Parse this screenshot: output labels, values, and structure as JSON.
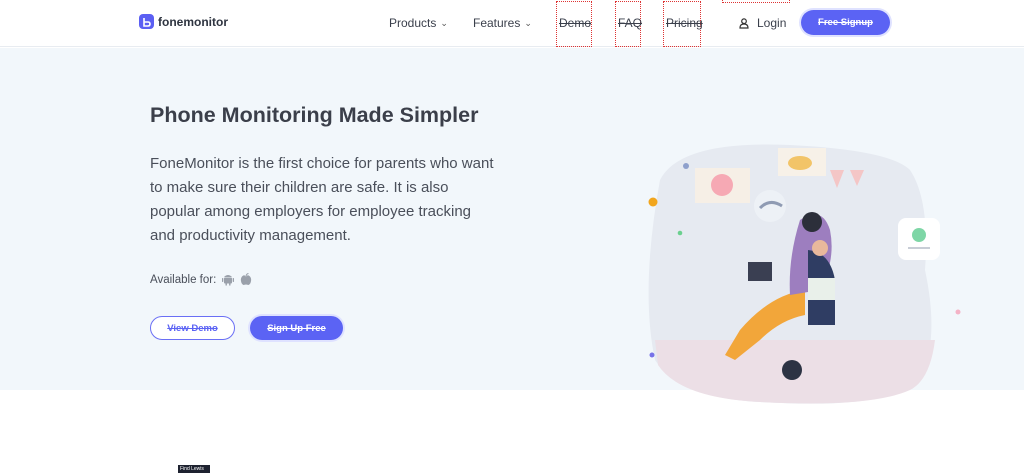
{
  "nav": {
    "logo": "fonemonitor",
    "items": [
      {
        "label": "Products"
      },
      {
        "label": "Features"
      },
      {
        "label": "Demo"
      },
      {
        "label": "FAQ"
      },
      {
        "label": "Pricing"
      }
    ],
    "login": "Login",
    "signup": "Free Signup"
  },
  "hero": {
    "title": "Phone Monitoring Made Simpler",
    "description": "FoneMonitor is the first choice for parents who want to make sure their children are safe. It is also popular among employers for employee tracking and productivity management.",
    "available_for": "Available for:",
    "platform_icons": [
      "android-icon",
      "apple-icon"
    ],
    "view_demo": "View Demo",
    "sign_up": "Sign Up Free"
  },
  "bottom": {
    "tag": "Find Lewis"
  },
  "colors": {
    "accent": "#5b63f4",
    "hero_bg": "#f2f7fb",
    "text": "#3b3f4a"
  }
}
